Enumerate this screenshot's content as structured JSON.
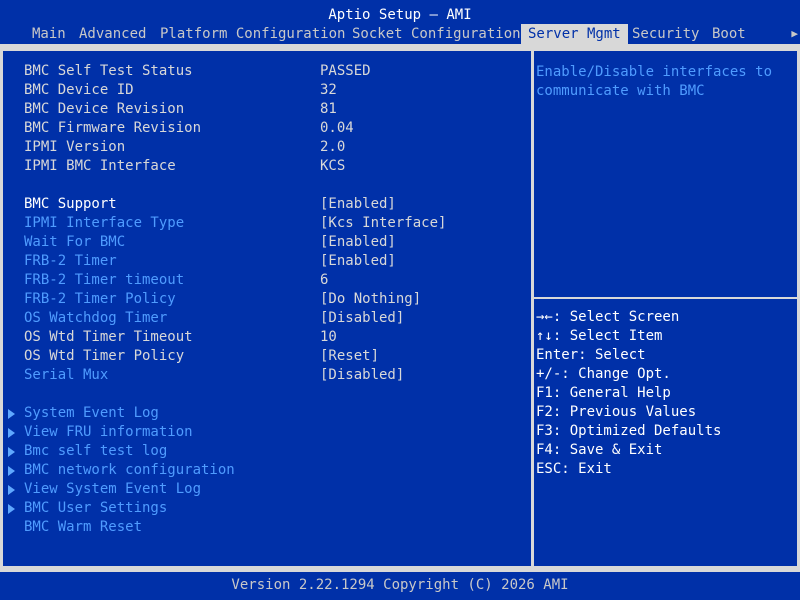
{
  "title": "Aptio Setup – AMI",
  "tabs": [
    "Main",
    "Advanced",
    "Platform Configuration",
    "Socket Configuration",
    "Server Mgmt",
    "Security",
    "Boot"
  ],
  "active_tab": "Server Mgmt",
  "info_rows": [
    {
      "label": "BMC Self Test Status",
      "value": "PASSED"
    },
    {
      "label": "BMC Device ID",
      "value": "32"
    },
    {
      "label": "BMC Device Revision",
      "value": "81"
    },
    {
      "label": "BMC Firmware Revision",
      "value": "0.04"
    },
    {
      "label": "IPMI Version",
      "value": "2.0"
    },
    {
      "label": "IPMI BMC Interface",
      "value": "KCS"
    }
  ],
  "settings": [
    {
      "label": "BMC Support",
      "value": "[Enabled]"
    },
    {
      "label": "IPMI Interface Type",
      "value": "[Kcs Interface]"
    },
    {
      "label": "Wait For BMC",
      "value": "[Enabled]"
    },
    {
      "label": "FRB-2 Timer",
      "value": "[Enabled]"
    },
    {
      "label": "FRB-2 Timer timeout",
      "value": "6"
    },
    {
      "label": "FRB-2 Timer Policy",
      "value": "[Do Nothing]"
    },
    {
      "label": "OS Watchdog Timer",
      "value": "[Disabled]"
    },
    {
      "label": "OS Wtd Timer Timeout",
      "value": "10"
    },
    {
      "label": "OS Wtd Timer Policy",
      "value": "[Reset]"
    },
    {
      "label": "Serial Mux",
      "value": "[Disabled]"
    }
  ],
  "submenus": [
    {
      "label": "System Event Log"
    },
    {
      "label": "View FRU information"
    },
    {
      "label": "Bmc self test log"
    },
    {
      "label": "BMC network configuration"
    },
    {
      "label": "View System Event Log"
    },
    {
      "label": "BMC User Settings"
    },
    {
      "label": "BMC Warm Reset"
    }
  ],
  "help": {
    "text": "Enable/Disable interfaces to communicate with BMC"
  },
  "keys": [
    "→←: Select Screen",
    "↑↓: Select Item",
    "Enter: Select",
    "+/-: Change Opt.",
    "F1: General Help",
    "F2: Previous Values",
    "F3: Optimized Defaults",
    "F4: Save & Exit",
    "ESC: Exit"
  ],
  "footer": "Version 2.22.1294 Copyright (C) 2026 AMI",
  "colors": {
    "background": "#0030a8",
    "frame": "#d8d8d8",
    "highlight_label": "#4f9cff"
  }
}
